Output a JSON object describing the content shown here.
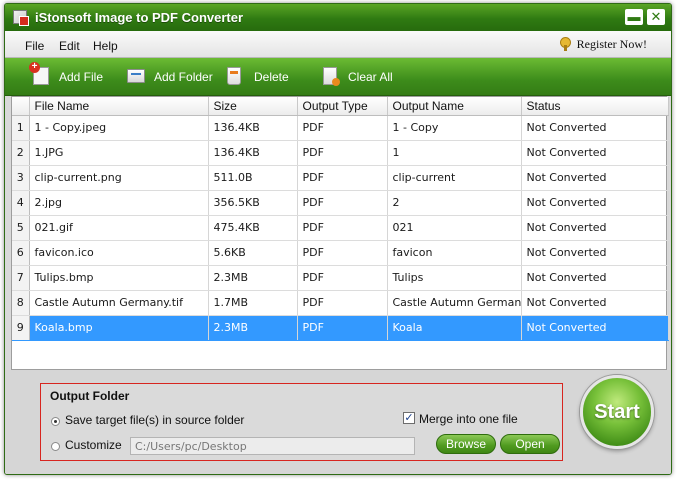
{
  "window": {
    "title": "iStonsoft Image to PDF Converter",
    "minimize_glyph": "▬",
    "close_glyph": "✕"
  },
  "menu": {
    "file": "File",
    "edit": "Edit",
    "help": "Help",
    "register": "Register Now!"
  },
  "toolbar": {
    "add_file": "Add File",
    "add_folder": "Add Folder",
    "delete": "Delete",
    "clear_all": "Clear All"
  },
  "table": {
    "headers": {
      "file_name": "File Name",
      "size": "Size",
      "output_type": "Output Type",
      "output_name": "Output Name",
      "status": "Status"
    },
    "rows": [
      {
        "index": "1",
        "file_name": "1 - Copy.jpeg",
        "size": "136.4KB",
        "output_type": "PDF",
        "output_name": "1 - Copy",
        "status": "Not Converted"
      },
      {
        "index": "2",
        "file_name": "1.JPG",
        "size": "136.4KB",
        "output_type": "PDF",
        "output_name": "1",
        "status": "Not Converted"
      },
      {
        "index": "3",
        "file_name": "clip-current.png",
        "size": "511.0B",
        "output_type": "PDF",
        "output_name": "clip-current",
        "status": "Not Converted"
      },
      {
        "index": "4",
        "file_name": "2.jpg",
        "size": "356.5KB",
        "output_type": "PDF",
        "output_name": "2",
        "status": "Not Converted"
      },
      {
        "index": "5",
        "file_name": "021.gif",
        "size": "475.4KB",
        "output_type": "PDF",
        "output_name": "021",
        "status": "Not Converted"
      },
      {
        "index": "6",
        "file_name": "favicon.ico",
        "size": "5.6KB",
        "output_type": "PDF",
        "output_name": "favicon",
        "status": "Not Converted"
      },
      {
        "index": "7",
        "file_name": "Tulips.bmp",
        "size": "2.3MB",
        "output_type": "PDF",
        "output_name": "Tulips",
        "status": "Not Converted"
      },
      {
        "index": "8",
        "file_name": "Castle Autumn Germany.tif",
        "size": "1.7MB",
        "output_type": "PDF",
        "output_name": "Castle Autumn Germany",
        "status": "Not Converted"
      },
      {
        "index": "9",
        "file_name": "Koala.bmp",
        "size": "2.3MB",
        "output_type": "PDF",
        "output_name": "Koala",
        "status": "Not Converted"
      }
    ],
    "selected_row": "9"
  },
  "output_folder": {
    "title": "Output Folder",
    "save_in_source_label": "Save target file(s) in source folder",
    "customize_label": "Customize",
    "path": "C:/Users/pc/Desktop",
    "merge_label": "Merge into one file",
    "merge_check_glyph": "✓",
    "browse": "Browse",
    "open": "Open"
  },
  "start": "Start",
  "colors": {
    "accent_green": "#3d8c1b",
    "selection_blue": "#3399ff",
    "highlight_red": "#d7251f"
  }
}
